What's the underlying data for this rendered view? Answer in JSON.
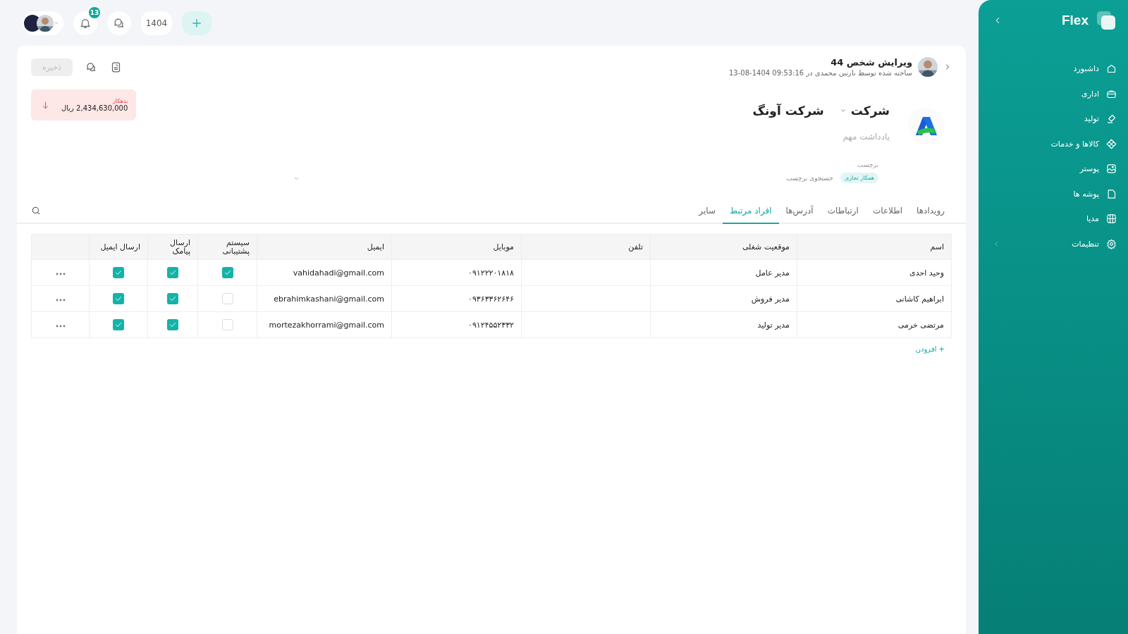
{
  "topbar": {
    "notifications": "13",
    "year": "1404"
  },
  "header": {
    "title": "ویرایش شخص 44",
    "subtitle": "ساخته شده توسط نازنین محمدی در 09:53:16 1404-08-13",
    "save": "ذخیره",
    "save_disabled": true
  },
  "company": {
    "type": "شرکت",
    "name": "شرکت آونگ",
    "note_placeholder": "یادداشت مهم"
  },
  "balance": {
    "label": "بدهکار",
    "amount": "2,434,630,000 ریال"
  },
  "tags": {
    "label": "برچسب",
    "items": [
      "همکار تجاری"
    ],
    "placeholder": "جستجوی برچسب"
  },
  "tabs": [
    {
      "label": "رویدادها",
      "selected": false
    },
    {
      "label": "اطلاعات",
      "selected": false
    },
    {
      "label": "ارتباطات",
      "selected": false
    },
    {
      "label": "آدرس‌ها",
      "selected": false
    },
    {
      "label": "افراد مرتبط",
      "selected": true
    },
    {
      "label": "سایر",
      "selected": false
    }
  ],
  "table": {
    "columns": [
      "اسم",
      "موقعیت شغلی",
      "تلفن",
      "موبایل",
      "ایمیل",
      "سیستم پشتیبانی",
      "ارسال پیامک",
      "ارسال ایمیل"
    ],
    "rows": [
      {
        "name": "وحید احدی",
        "position": "مدیر عامل",
        "mobile": "۰۹۱۲۲۲۰۱۸۱۸",
        "email": "vahidahadi@gmail.com",
        "support": true,
        "sms": true,
        "send_email": true
      },
      {
        "name": "ابراهیم کاشانی",
        "position": "مدیر فروش",
        "mobile": "۰۹۳۶۳۳۶۲۶۴۶",
        "email": "ebrahimkashani@gmail.com",
        "support": false,
        "sms": true,
        "send_email": true
      },
      {
        "name": "مرتضی خرمی",
        "position": "مدیر تولید",
        "mobile": "۰۹۱۲۴۵۵۲۳۳۲",
        "email": "mortezakhorrami@gmail.com",
        "support": false,
        "sms": true,
        "send_email": true
      }
    ],
    "add": "+ افزودن"
  },
  "sidebar": {
    "brand": "Flex",
    "items": [
      {
        "label": "داشبورد",
        "expandable": false
      },
      {
        "label": "اداری",
        "expandable": false
      },
      {
        "label": "تولید",
        "expandable": false
      },
      {
        "label": "کالاها و خدمات",
        "expandable": false
      },
      {
        "label": "پوستر",
        "expandable": false
      },
      {
        "label": "پوشه ها",
        "expandable": false
      },
      {
        "label": "مدیا",
        "expandable": false
      },
      {
        "label": "تنظیمات",
        "expandable": true
      }
    ]
  }
}
